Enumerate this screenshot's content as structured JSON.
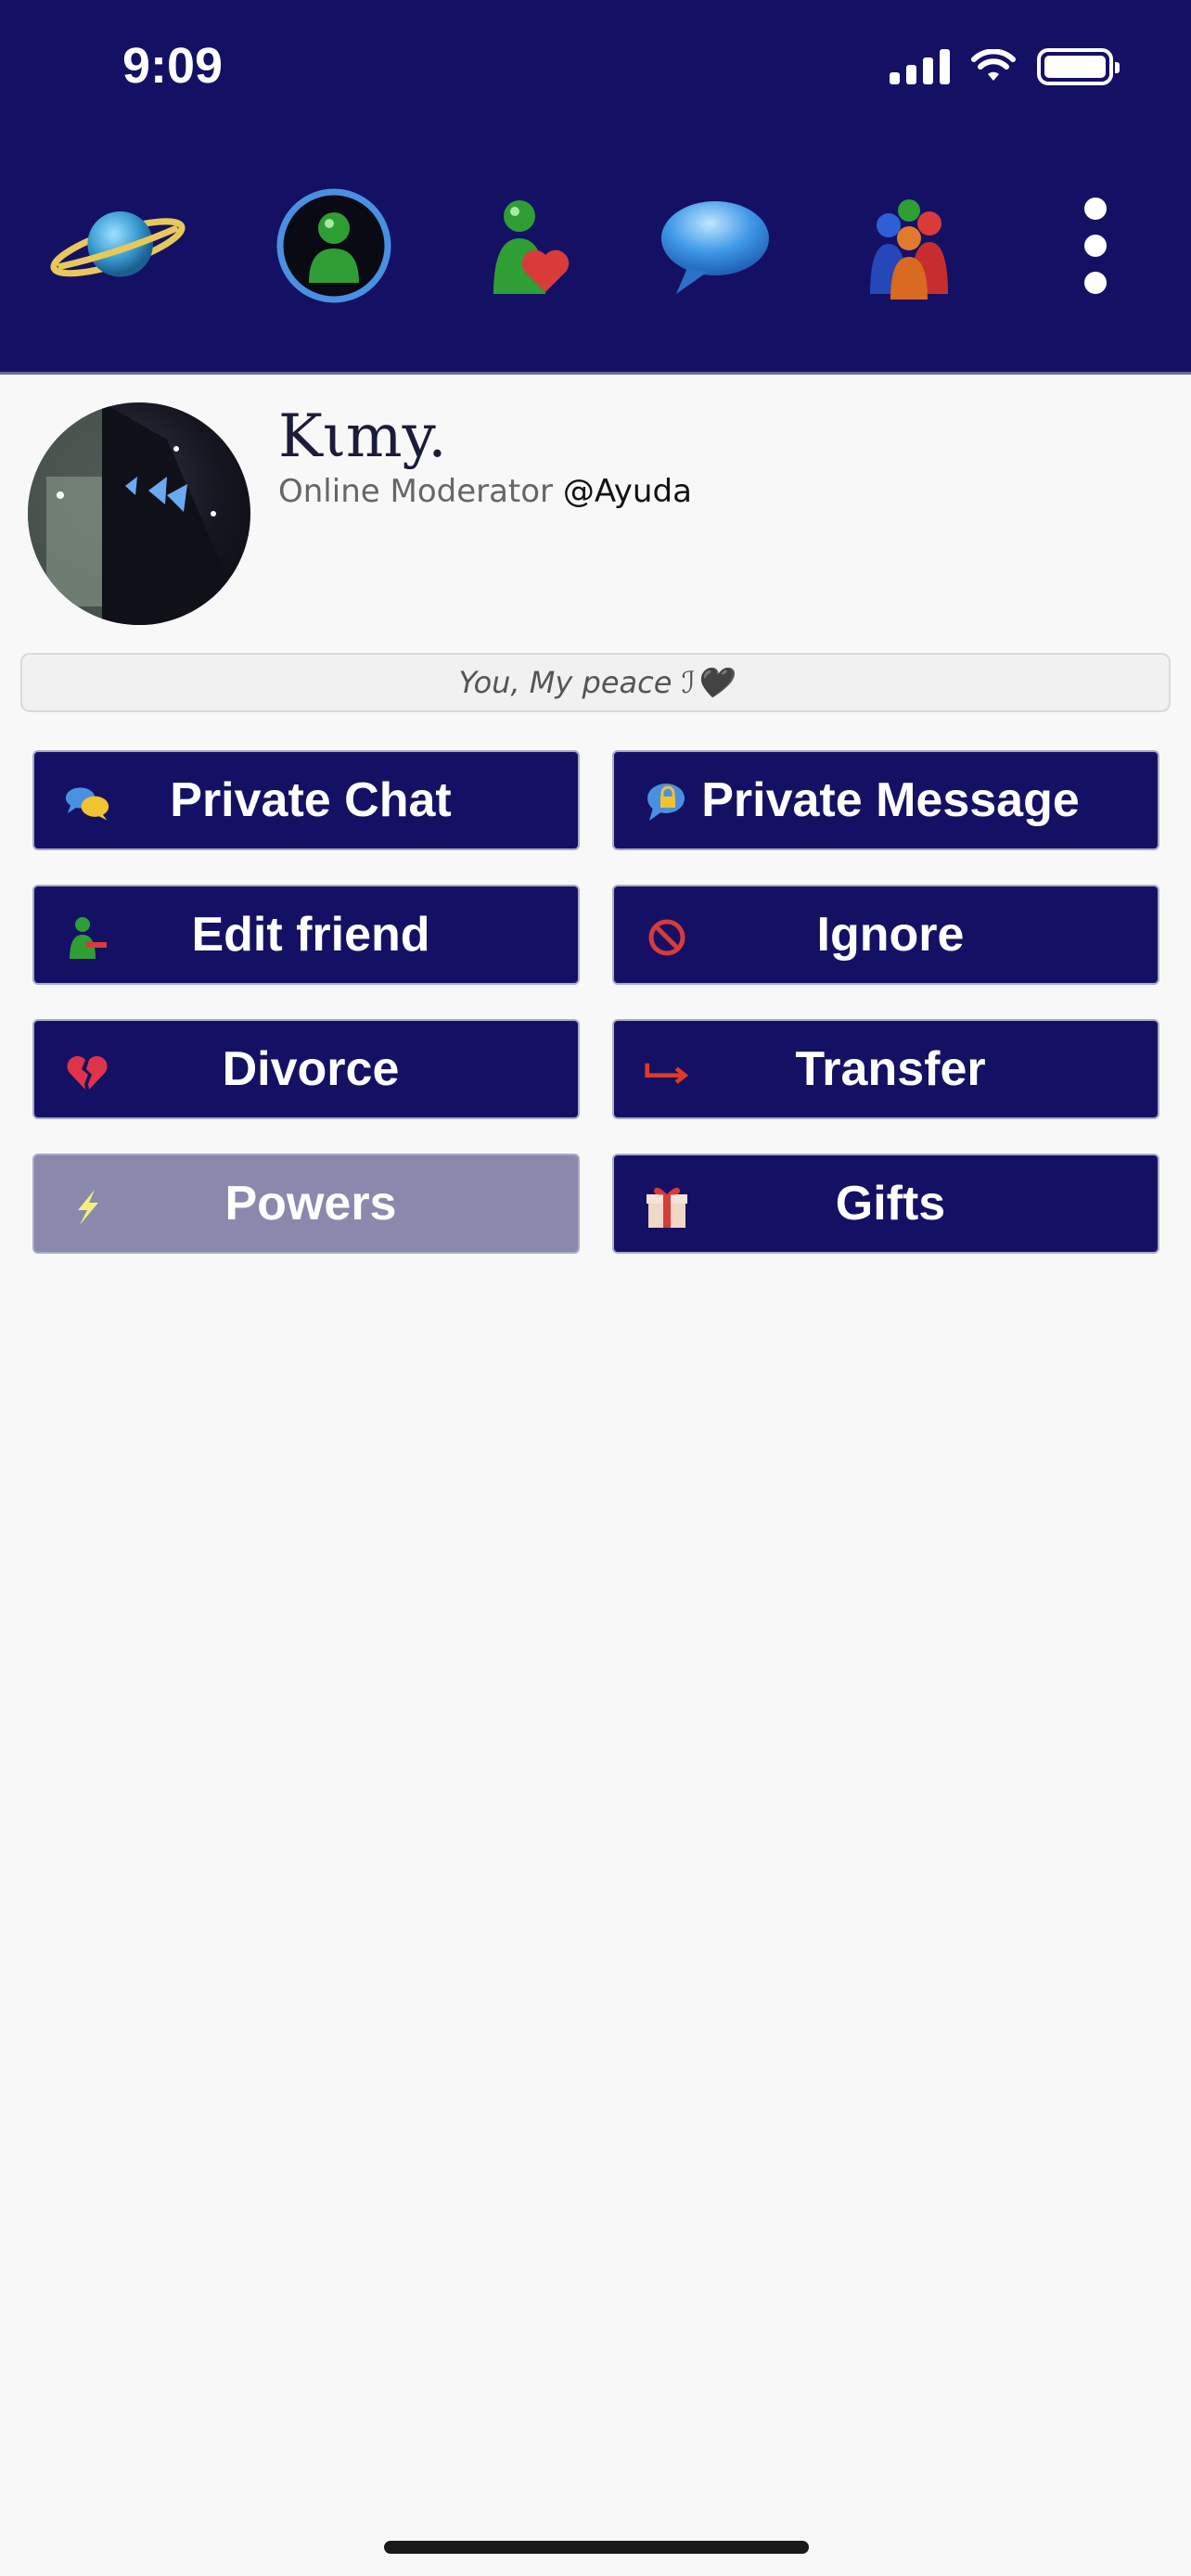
{
  "status_bar": {
    "time": "9:09"
  },
  "colors": {
    "header_bg": "#141165",
    "button_bg": "#141165",
    "button_disabled_bg": "#8a89ad",
    "page_bg": "#f8f8f8"
  },
  "nav": {
    "items": [
      {
        "icon": "planet-icon",
        "label": ""
      },
      {
        "icon": "user-profile-icon",
        "label": ""
      },
      {
        "icon": "friend-heart-icon",
        "label": ""
      },
      {
        "icon": "chat-bubble-icon",
        "label": ""
      },
      {
        "icon": "users-group-icon",
        "label": ""
      },
      {
        "icon": "more-vertical-icon",
        "label": ""
      }
    ],
    "active_index": 1
  },
  "profile": {
    "name": "Kιmy.",
    "role": "Online Moderator",
    "handle": "@Ayuda",
    "status_message": "You, My peace ℐ🖤"
  },
  "actions": [
    {
      "label": "Private Chat",
      "icon": "chat-bubbles-icon",
      "enabled": true
    },
    {
      "label": "Private Message",
      "icon": "lock-message-icon",
      "enabled": true
    },
    {
      "label": "Edit friend",
      "icon": "remove-friend-icon",
      "enabled": true
    },
    {
      "label": "Ignore",
      "icon": "block-icon",
      "enabled": true
    },
    {
      "label": "Divorce",
      "icon": "broken-heart-icon",
      "enabled": true
    },
    {
      "label": "Transfer",
      "icon": "arrow-transfer-icon",
      "enabled": true
    },
    {
      "label": "Powers",
      "icon": "lightning-icon",
      "enabled": false
    },
    {
      "label": "Gifts",
      "icon": "gift-icon",
      "enabled": true
    }
  ]
}
